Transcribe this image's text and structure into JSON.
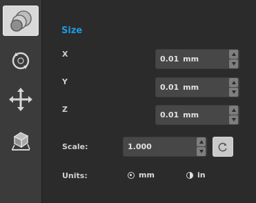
{
  "sidebar": {
    "tools": [
      {
        "icon": "size-icon",
        "active": true
      },
      {
        "icon": "rotate-icon",
        "active": false
      },
      {
        "icon": "move-icon",
        "active": false
      },
      {
        "icon": "place-on-face-icon",
        "active": false
      }
    ]
  },
  "panel": {
    "title": "Size",
    "x": {
      "label": "X",
      "value": "0.01",
      "unit": "mm"
    },
    "y": {
      "label": "Y",
      "value": "0.01",
      "unit": "mm"
    },
    "z": {
      "label": "Z",
      "value": "0.01",
      "unit": "mm"
    },
    "scale": {
      "label": "Scale:",
      "value": "1.000"
    },
    "units": {
      "label": "Units:",
      "options": [
        {
          "label": "mm",
          "selected": true
        },
        {
          "label": "in",
          "selected": false
        }
      ]
    }
  },
  "colors": {
    "accent": "#1f9be3",
    "background": "#2b2b2b",
    "sidebar": "#3b3b3b",
    "field": "#474747"
  }
}
